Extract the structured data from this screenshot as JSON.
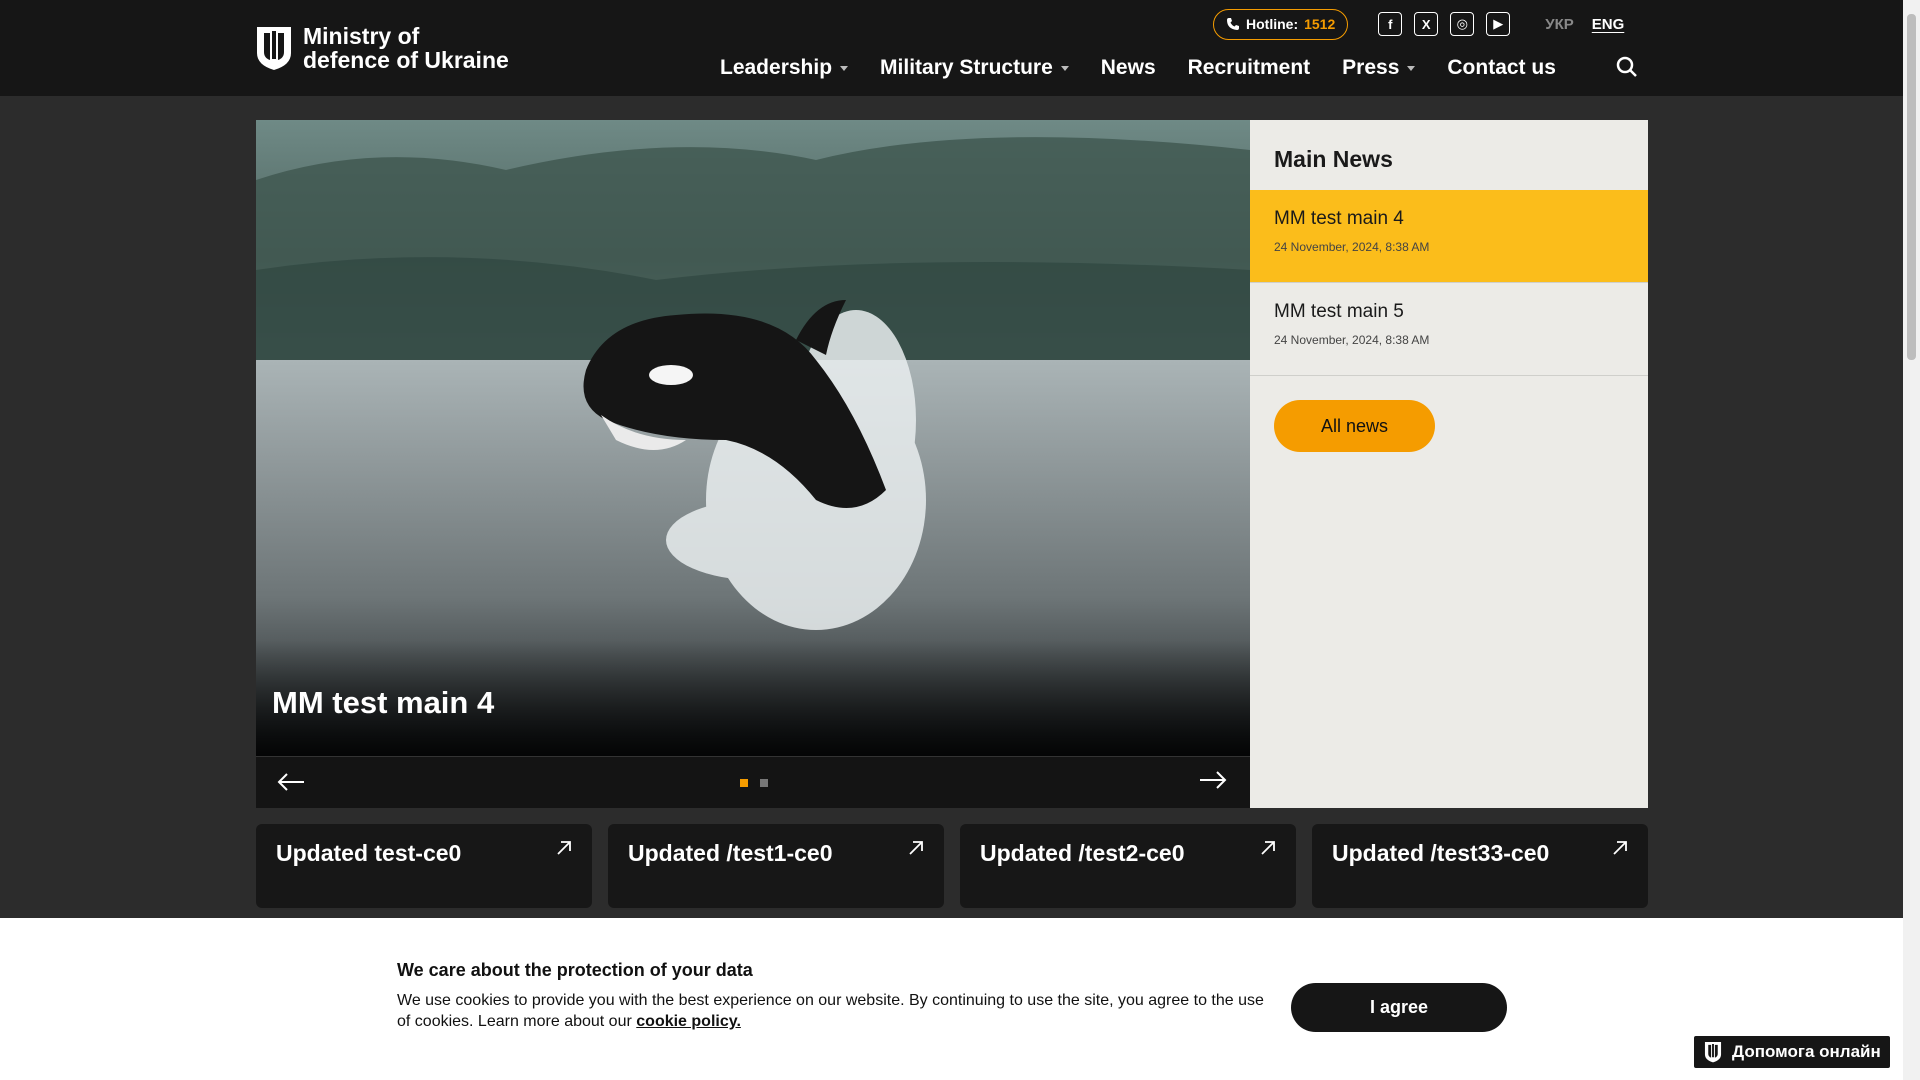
{
  "header": {
    "logo_line1": "Ministry of",
    "logo_line2": "defence of Ukraine",
    "hotline_label": "Hotline:",
    "hotline_number": "1512",
    "socials": [
      "f",
      "X",
      "◎",
      "▶"
    ],
    "lang_ukr": "УКР",
    "lang_eng": "ENG",
    "nav": [
      "Leadership",
      "Military Structure",
      "News",
      "Recruitment",
      "Press",
      "Contact us"
    ]
  },
  "slider": {
    "title": "MM test main 4",
    "dots_total": 2,
    "active_dot": 1
  },
  "main_news": {
    "title": "Main News",
    "items": [
      {
        "title": "MM test main 4",
        "date": "24 November, 2024, 8:38 AM"
      },
      {
        "title": "MM test main 5",
        "date": "24 November, 2024, 8:38 AM"
      }
    ],
    "all_news_label": "All news"
  },
  "cards": [
    "Updated test-ce0",
    "Updated /test1-ce0",
    "Updated /test2-ce0",
    "Updated /test33-ce0"
  ],
  "cookie": {
    "title": "We care about the protection of your data",
    "text": "We use cookies to provide you with the best experience on our website. By continuing to use the site, you agree to the use of cookies. Learn more about our",
    "link": "cookie policy.",
    "agree_label": "I agree"
  },
  "help_label": "Допомога онлайн",
  "colors": {
    "accent": "#f59c00",
    "highlight": "#fbbd1b",
    "header_bg": "#161616",
    "page_bg": "#2c2c2c"
  }
}
